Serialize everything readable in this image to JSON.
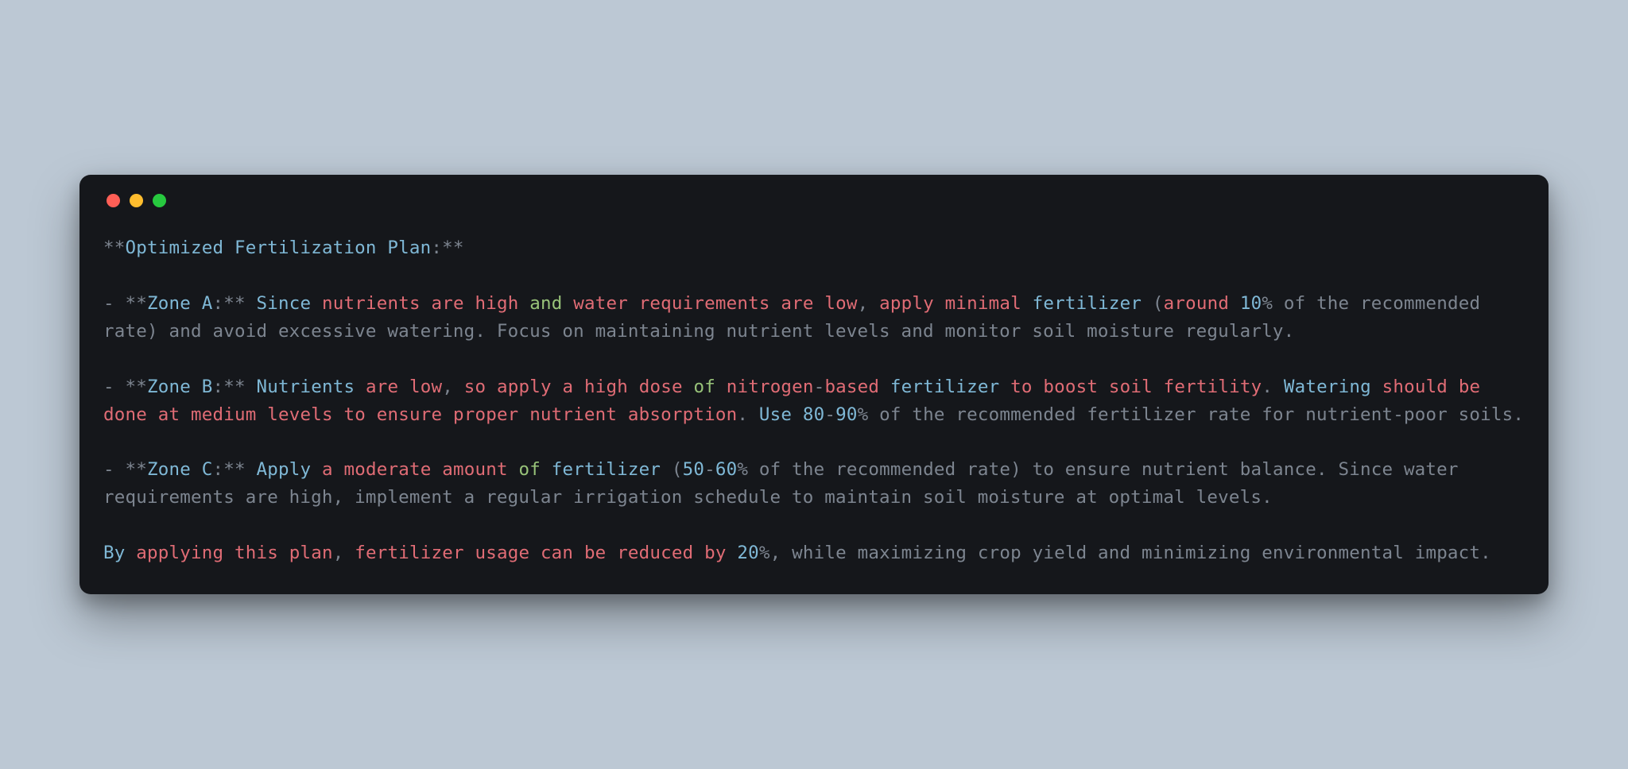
{
  "code": {
    "title_mark1": "**",
    "title_word1": "Optimized",
    "title_word2": "Fertilization",
    "title_word3": "Plan",
    "title_colon_mark": ":**",
    "zA_dash": "- ",
    "zA_mark1": "**",
    "zA_zone": "Zone",
    "zA_A": "A",
    "zA_colon_mark": ":**",
    "zA_since": "Since",
    "zA_nutrients": "nutrients",
    "zA_are1": "are",
    "zA_high": "high",
    "zA_and": "and",
    "zA_water": "water",
    "zA_req": "requirements",
    "zA_are2": "are",
    "zA_low": "low",
    "zA_comma1": ",",
    "zA_apply": "apply",
    "zA_minimal": "minimal",
    "zA_fert": "fertilizer",
    "zA_paren": "(",
    "zA_around": "around",
    "zA_10": "10",
    "zA_pct": "%",
    "zA_rest": " of the recommended rate) and avoid excessive watering. Focus on maintaining nutrient levels and monitor soil moisture regularly.",
    "zB_dash": "- ",
    "zB_mark1": "**",
    "zB_zone": "Zone",
    "zB_B": "B",
    "zB_colon_mark": ":**",
    "zB_Nutrients": "Nutrients",
    "zB_are1": "are",
    "zB_low": "low",
    "zB_comma1": ",",
    "zB_so": "so",
    "zB_apply": "apply",
    "zB_a1": "a",
    "zB_highw": "high",
    "zB_dose": "dose",
    "zB_of": "of",
    "zB_nitrogen": "nitrogen",
    "zB_dash2": "-",
    "zB_based": "based",
    "zB_fert": "fertilizer",
    "zB_to": "to",
    "zB_boost": "boost",
    "zB_soil": "soil",
    "zB_fertility": "fertility",
    "zB_dot1": ".",
    "zB_Watering": "Watering",
    "zB_should": "should",
    "zB_be": "be",
    "zB_done": "done",
    "zB_at": "at",
    "zB_medium": "medium",
    "zB_levels": "levels",
    "zB_to2": "to",
    "zB_ensure": "ensure",
    "zB_proper": "proper",
    "zB_nutrient": "nutrient",
    "zB_absorption": "absorption",
    "zB_dot2": ".",
    "zB_Use": "Use",
    "zB_80": "80",
    "zB_rdash": "-",
    "zB_90": "90",
    "zB_pct": "%",
    "zB_rest": " of the recommended fertilizer rate for nutrient-poor soils.",
    "zC_dash": "- ",
    "zC_mark1": "**",
    "zC_zone": "Zone",
    "zC_C": "C",
    "zC_colon_mark": ":**",
    "zC_Apply": "Apply",
    "zC_a": "a",
    "zC_moderate": "moderate",
    "zC_amount": "amount",
    "zC_of": "of",
    "zC_fert": "fertilizer",
    "zC_paren": "(",
    "zC_50": "50",
    "zC_rdash": "-",
    "zC_60": "60",
    "zC_pct": "%",
    "zC_rest": " of the recommended rate) to ensure nutrient balance. Since water requirements are high, implement a regular irrigation schedule to maintain soil moisture at optimal levels.",
    "sum_By": "By",
    "sum_applying": "applying",
    "sum_this": "this",
    "sum_plan": "plan",
    "sum_comma": ",",
    "sum_fert": "fertilizer",
    "sum_usage": "usage",
    "sum_can": "can",
    "sum_be": "be",
    "sum_reduced": "reduced",
    "sum_by": "by",
    "sum_20": "20",
    "sum_pct": "%",
    "sum_comma2": ",",
    "sum_rest": " while maximizing crop yield and minimizing environmental impact."
  }
}
